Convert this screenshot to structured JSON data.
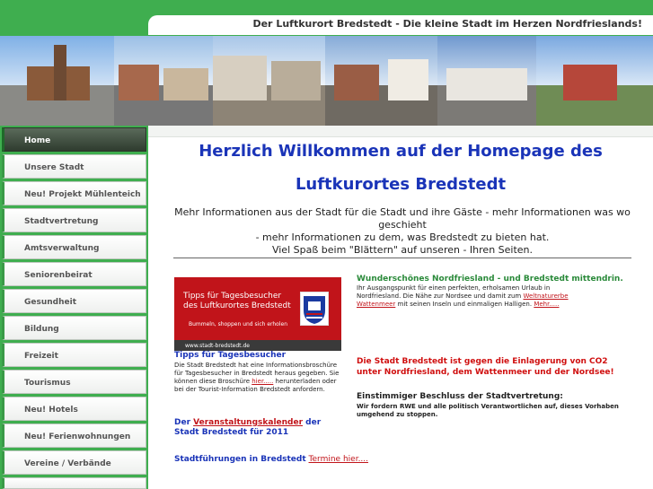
{
  "header": {
    "title": "Der Luftkurort Bredstedt - Die kleine Stadt im Herzen Nordfrieslands!"
  },
  "sidebar": {
    "items": [
      {
        "label": "Home",
        "active": true
      },
      {
        "label": "Unsere Stadt"
      },
      {
        "label": "Neu! Projekt Mühlenteich"
      },
      {
        "label": "Stadtvertretung"
      },
      {
        "label": "Amtsverwaltung"
      },
      {
        "label": "Seniorenbeirat"
      },
      {
        "label": "Gesundheit"
      },
      {
        "label": "Bildung"
      },
      {
        "label": "Freizeit"
      },
      {
        "label": "Tourismus"
      },
      {
        "label": "Neu! Hotels"
      },
      {
        "label": "Neu! Ferienwohnungen"
      },
      {
        "label": "Vereine / Verbände"
      }
    ]
  },
  "main": {
    "heading_line1": "Herzlich Willkommen auf der Homepage des",
    "heading_line2": "Luftkurortes Bredstedt",
    "intro_line1": "Mehr Informationen aus der Stadt für die Stadt und ihre Gäste - mehr Informationen was wo geschieht",
    "intro_line2": "- mehr Informationen zu dem, was Bredstedt zu bieten hat.",
    "intro_line3": "Viel Spaß beim \"Blättern\" auf unseren - Ihren Seiten.",
    "tips_banner": {
      "line1": "Tipps für Tagesbesucher",
      "line2": "des Luftkurortes Bredstedt",
      "line3": "Bummeln, shoppen und sich erholen",
      "url": "www.stadt-bredstedt.de"
    },
    "tips_title": "Tipps für Tagesbesucher",
    "tips_text_1": "Die Stadt Bredstedt hat eine Informationsbroschüre für",
    "tips_text_2": "Tagesbesucher in Bredstedt heraus gegeben. Sie können diese Broschüre",
    "tips_link": "hier.....",
    "tips_text_3": "herunterladen oder bei der Tourist-Information Bredstedt anfordern.",
    "calendar_pre": "Der",
    "calendar_link": "Veranstaltungskalender",
    "calendar_post": "der Stadt Bredstedt für  2011",
    "tours_text": "Stadtführungen in Bredstedt",
    "tours_link": "Termine hier....",
    "nf_title": "Wunderschönes Nordfriesland - und Bredstedt mittendrin.",
    "nf_text_1": "Ihr Ausgangspunkt für einen perfekten, erholsamen Urlaub in Nordfriesland. Die Nähe zur Nordsee und damit zum",
    "nf_link": "Weltnaturerbe Wattenmeer",
    "nf_text_2": "mit seinen Inseln und einmaligen Halligen.",
    "nf_more": "Mehr.....",
    "co2_line1": "Die Stadt Bredstedt ist gegen die Einlagerung von CO2",
    "co2_line2": "unter Nordfriesland, dem Wattenmeer und der Nordsee!",
    "vote_title": "Einstimmiger Beschluss der Stadtvertretung:",
    "vote_text": "Wir fordern RWE und alle politisch Verantwortlichen auf, dieses Vorhaben umgehend zu stoppen."
  },
  "colors": {
    "accent_green": "#3fae4f",
    "heading_blue": "#1a34b8",
    "alert_red": "#d01010",
    "link_red": "#c1141a"
  }
}
